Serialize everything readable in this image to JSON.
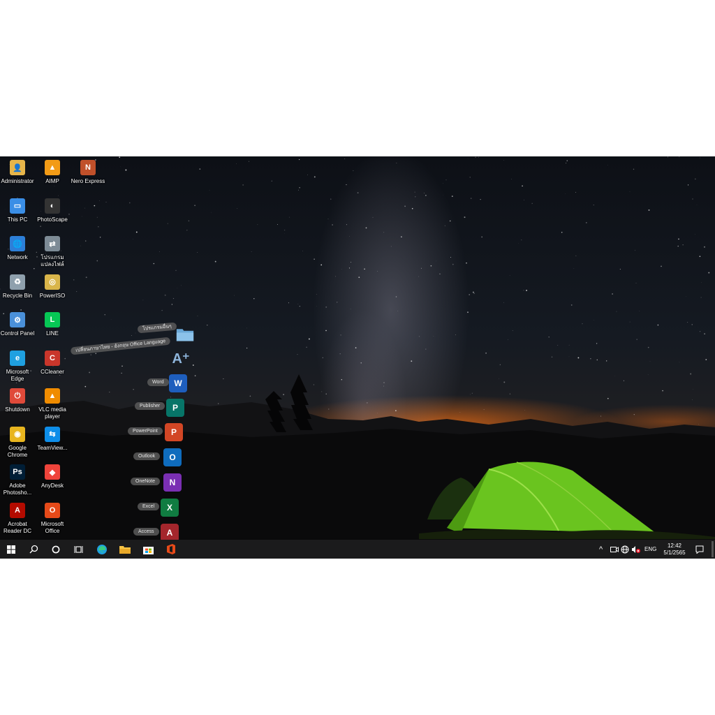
{
  "desktop_icons": [
    {
      "label": "Administrator",
      "icon": "user-folder-icon"
    },
    {
      "label": "AIMP",
      "icon": "aimp-icon"
    },
    {
      "label": "Nero Express",
      "icon": "nero-icon"
    },
    {
      "label": "This PC",
      "icon": "computer-icon"
    },
    {
      "label": "PhotoScape",
      "icon": "photoscape-icon"
    },
    {
      "label": "Network",
      "icon": "network-icon"
    },
    {
      "label": "โปรแกรมแปลงไฟล์",
      "icon": "file-converter-icon"
    },
    {
      "label": "Recycle Bin",
      "icon": "recycle-bin-icon"
    },
    {
      "label": "PowerISO",
      "icon": "poweriso-icon"
    },
    {
      "label": "Control Panel",
      "icon": "control-panel-icon"
    },
    {
      "label": "LINE",
      "icon": "line-icon"
    },
    {
      "label": "Microsoft Edge",
      "icon": "edge-icon"
    },
    {
      "label": "CCleaner",
      "icon": "ccleaner-icon"
    },
    {
      "label": "Shutdown",
      "icon": "power-icon"
    },
    {
      "label": "VLC media player",
      "icon": "vlc-icon"
    },
    {
      "label": "Google Chrome",
      "icon": "chrome-icon"
    },
    {
      "label": "TeamView...",
      "icon": "teamviewer-icon"
    },
    {
      "label": "Adobe Photosho...",
      "icon": "photoshop-icon"
    },
    {
      "label": "AnyDesk",
      "icon": "anydesk-icon"
    },
    {
      "label": "Acrobat Reader DC",
      "icon": "acrobat-icon"
    },
    {
      "label": "Microsoft Office",
      "icon": "office-icon"
    }
  ],
  "dock_menu": [
    {
      "label": "โปรแกรมอื่นๆ",
      "icon": "folder-icon",
      "color": "#6aa8d8"
    },
    {
      "label": "เปลี่ยนภาษาไทย - อังกฤษ Office Language",
      "icon": "language-icon",
      "color": "#8fb6dc"
    },
    {
      "label": "Word",
      "icon": "word-icon",
      "letter": "W",
      "color": "#1e5ebd"
    },
    {
      "label": "Publisher",
      "icon": "publisher-icon",
      "letter": "P",
      "color": "#077568"
    },
    {
      "label": "PowerPoint",
      "icon": "powerpoint-icon",
      "letter": "P",
      "color": "#d24625"
    },
    {
      "label": "Outlook",
      "icon": "outlook-icon",
      "letter": "O",
      "color": "#0f6cbd"
    },
    {
      "label": "OneNote",
      "icon": "onenote-icon",
      "letter": "N",
      "color": "#7a2fb3"
    },
    {
      "label": "Excel",
      "icon": "excel-icon",
      "letter": "X",
      "color": "#107c41"
    },
    {
      "label": "Access",
      "icon": "access-icon",
      "letter": "A",
      "color": "#a4262c"
    }
  ],
  "taskbar": {
    "apps": [
      "windows-start-icon",
      "search-icon",
      "cortana-icon",
      "task-view-icon",
      "edge-icon",
      "file-explorer-icon",
      "store-icon",
      "office-icon"
    ],
    "tray": {
      "chevron": "^",
      "language": "ENG",
      "time": "12:42",
      "date": "5/1/2565"
    }
  }
}
